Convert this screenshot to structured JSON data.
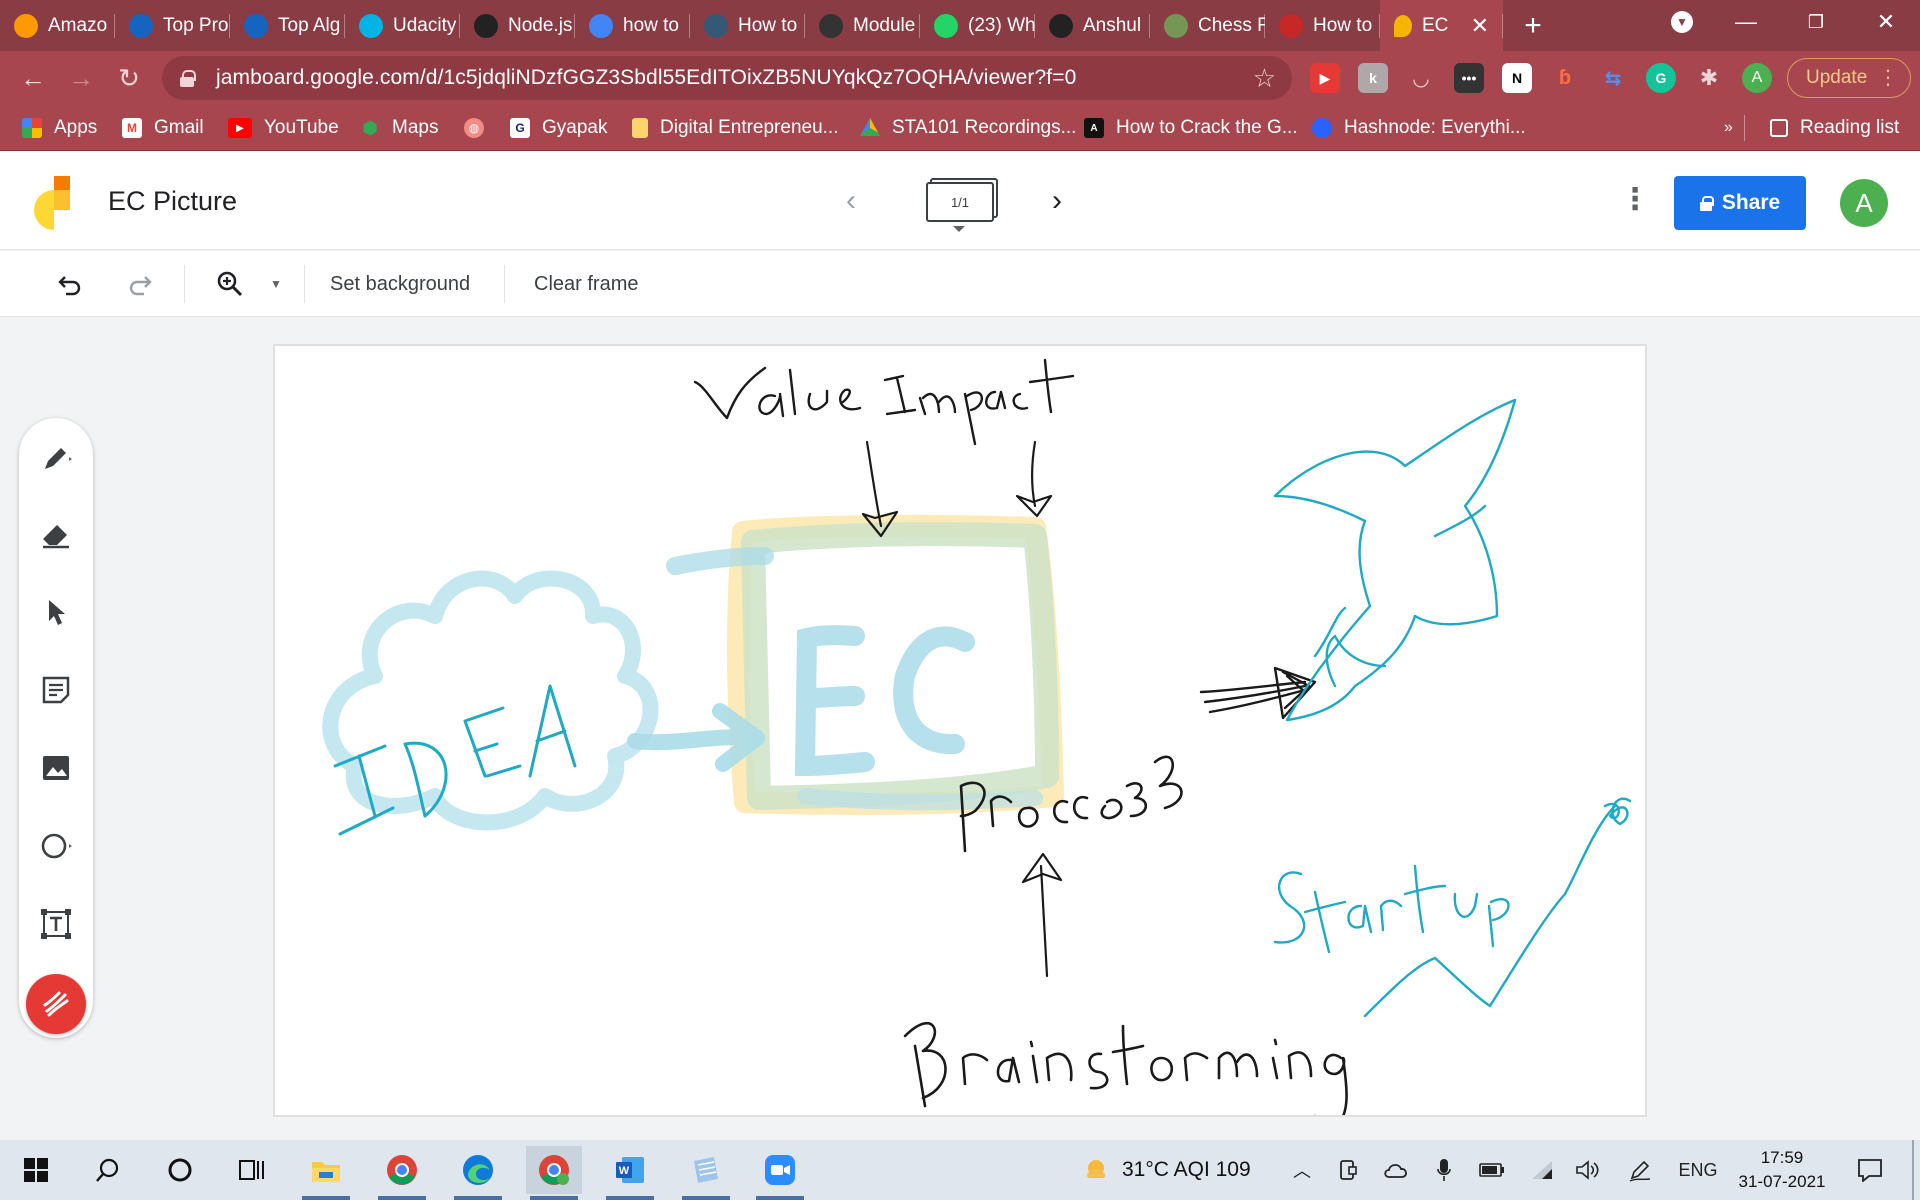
{
  "browser": {
    "tabs": [
      {
        "label": "Amazo",
        "icon": "amazon-icon",
        "color": "#ff9900"
      },
      {
        "label": "Top Pro",
        "icon": "c-icon",
        "color": "#1565c0"
      },
      {
        "label": "Top Alg",
        "icon": "c-icon",
        "color": "#1565c0"
      },
      {
        "label": "Udacity",
        "icon": "udacity-icon",
        "color": "#02b3e4"
      },
      {
        "label": "Node.js",
        "icon": "node-icon",
        "color": "#222222"
      },
      {
        "label": "how to",
        "icon": "google-icon",
        "color": "#4285f4"
      },
      {
        "label": "How to",
        "icon": "tds-icon",
        "color": "#355876"
      },
      {
        "label": "Module",
        "icon": "module-icon",
        "color": "#333333"
      },
      {
        "label": "(23) Wh",
        "icon": "whatsapp-icon",
        "color": "#25d366"
      },
      {
        "label": "Anshul",
        "icon": "github-icon",
        "color": "#222222"
      },
      {
        "label": "Chess F",
        "icon": "chess-icon",
        "color": "#769656"
      },
      {
        "label": "How to",
        "icon": "x-icon",
        "color": "#c62828"
      }
    ],
    "active_tab": {
      "label": "EC",
      "icon": "jamboard-icon"
    },
    "new_tab_symbol": "+",
    "url": "jamboard.google.com/d/1c5jdqliNDzfGGZ3Sbdl55EdITOixZB5NUYqkQz7OQHA/viewer?f=0",
    "profile_letter": "A",
    "update_label": "Update"
  },
  "bookmarks": [
    {
      "label": "Apps",
      "icon": "apps-grid-icon"
    },
    {
      "label": "Gmail",
      "icon": "gmail-icon"
    },
    {
      "label": "YouTube",
      "icon": "youtube-icon"
    },
    {
      "label": "Maps",
      "icon": "maps-icon"
    },
    {
      "label": "",
      "icon": "globe-icon"
    },
    {
      "label": "Gyapak",
      "icon": "g-icon"
    },
    {
      "label": "Digital Entrepreneu...",
      "icon": "folder-icon"
    },
    {
      "label": "STA101 Recordings...",
      "icon": "drive-icon"
    },
    {
      "label": "How to Crack the G...",
      "icon": "a-icon"
    },
    {
      "label": "Hashnode: Everythi...",
      "icon": "hashnode-icon"
    }
  ],
  "bookmarks_overflow": "»",
  "reading_list": "Reading list",
  "jamboard": {
    "title": "EC Picture",
    "frame_counter": "1/1",
    "share_label": "Share",
    "avatar_letter": "A",
    "toolbar": {
      "set_background": "Set background",
      "clear_frame": "Clear frame"
    },
    "colors": {
      "share": "#1a73e8",
      "avatar": "#4caf50",
      "laser": "#e53935",
      "ink_teal": "#1fa9c4",
      "ink_black": "#1a1a1a"
    }
  },
  "taskbar": {
    "weather": "31°C  AQI 109",
    "language": "ENG",
    "time": "17:59",
    "date": "31-07-2021"
  }
}
